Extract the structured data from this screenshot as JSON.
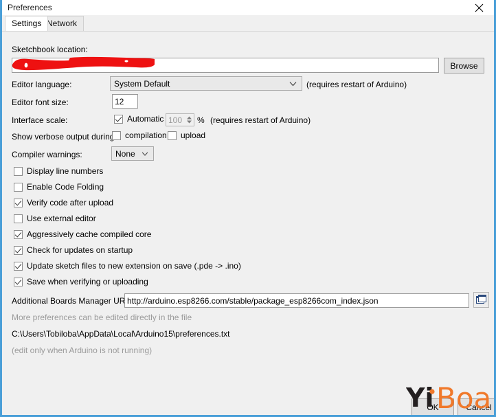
{
  "window": {
    "title": "Preferences",
    "close_icon": "close-x-icon"
  },
  "tabs": [
    {
      "label": "Settings",
      "active": true
    },
    {
      "label": "Network",
      "active": false
    }
  ],
  "settings": {
    "sketchbook": {
      "label": "Sketchbook location:",
      "value": "",
      "redacted": true,
      "browse_label": "Browse"
    },
    "editor_language": {
      "label": "Editor language:",
      "value": "System Default",
      "hint": "(requires restart of Arduino)",
      "chevron_icon": "chevron-down-icon"
    },
    "editor_font_size": {
      "label": "Editor font size:",
      "value": "12"
    },
    "interface_scale": {
      "label": "Interface scale:",
      "automatic_label": "Automatic",
      "automatic_checked": true,
      "percent_value": "100",
      "percent_symbol": "%",
      "hint": "(requires restart of Arduino)",
      "spinner_up_icon": "spinner-up-arrow-icon",
      "spinner_down_icon": "spinner-down-arrow-icon"
    },
    "verbose_output": {
      "label": "Show verbose output during:",
      "compilation_label": "compilation",
      "compilation_checked": false,
      "upload_label": "upload",
      "upload_checked": false
    },
    "compiler_warnings": {
      "label": "Compiler warnings:",
      "value": "None",
      "chevron_icon": "chevron-down-icon"
    },
    "options": [
      {
        "label": "Display line numbers",
        "checked": false
      },
      {
        "label": "Enable Code Folding",
        "checked": false
      },
      {
        "label": "Verify code after upload",
        "checked": true
      },
      {
        "label": "Use external editor",
        "checked": false
      },
      {
        "label": "Aggressively cache compiled core",
        "checked": true
      },
      {
        "label": "Check for updates on startup",
        "checked": true
      },
      {
        "label": "Update sketch files to new extension on save (.pde -> .ino)",
        "checked": true
      },
      {
        "label": "Save when verifying or uploading",
        "checked": true
      }
    ],
    "boards_manager": {
      "label": "Additional Boards Manager URLs:",
      "value": "http://arduino.esp8266.com/stable/package_esp8266com_index.json",
      "copy_icon": "window-copy-icon"
    },
    "footer": {
      "more_preferences": "More preferences can be edited directly in the file",
      "file_path": "C:\\Users\\Tobiloba\\AppData\\Local\\Arduino15\\preferences.txt",
      "edit_warning": "(edit only when Arduino is not running)"
    }
  },
  "actions": {
    "ok_label": "OK",
    "cancel_label": "Cancel"
  },
  "watermark": {
    "text_dark": "Yi",
    "text_orange": "Board",
    "color_dark": "#231f20",
    "color_orange": "#f0792b"
  },
  "colors": {
    "window_border": "#4a9fd8",
    "dialog_background": "#f0f0f0",
    "redaction": "#ee1111",
    "muted_text": "#9b9b9b"
  }
}
